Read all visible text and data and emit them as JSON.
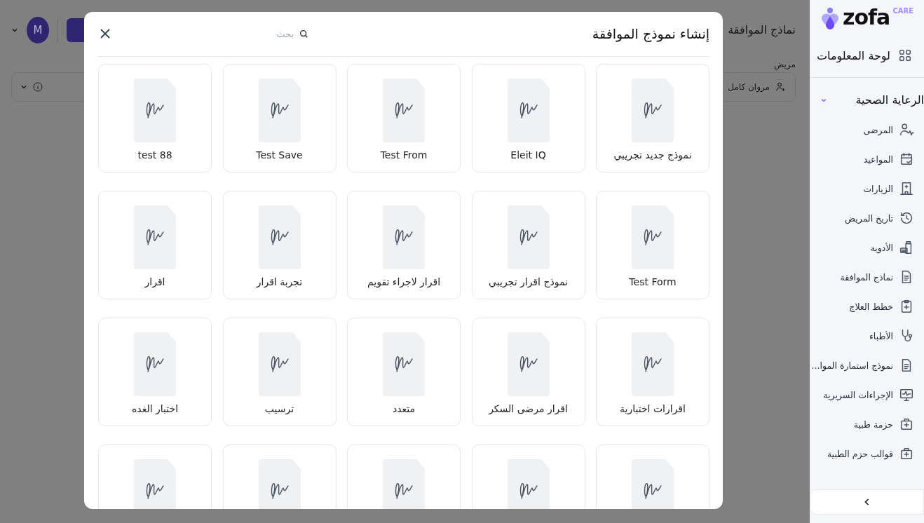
{
  "main": {
    "avatar": "M",
    "title": "نماذج الموافقة",
    "patient_label": "مريض",
    "patient_value": "مروان كامل"
  },
  "sidebar": {
    "logo": {
      "name": "zofa",
      "tag": "CARE"
    },
    "dashboard": "لوحة المعلومات",
    "group": {
      "label": "الرعاية الصحية",
      "expanded": true,
      "items": [
        {
          "label": "المرضى"
        },
        {
          "label": "المواعيد"
        },
        {
          "label": "الزيارات"
        },
        {
          "label": "تاريخ المريض"
        },
        {
          "label": "الأدوية"
        },
        {
          "label": "نماذج الموافقة"
        },
        {
          "label": "خطط العلاج"
        },
        {
          "label": "الأطباء"
        },
        {
          "label": "نموذج استمارة الموا..."
        },
        {
          "label": "الإجراءات السريرية"
        },
        {
          "label": "حزمة طبية"
        },
        {
          "label": "قوالب حزم الطبية"
        }
      ]
    }
  },
  "modal": {
    "title": "إنشاء نموذج الموافقة",
    "search": {
      "placeholder": "بحث"
    },
    "templates": [
      {
        "kind": "form",
        "title": "نموذج جديد تجريبي"
      },
      {
        "kind": "form",
        "title": "Eleit IQ"
      },
      {
        "kind": "form",
        "title": "Test From"
      },
      {
        "kind": "form",
        "title": "Test Save"
      },
      {
        "kind": "form",
        "title": "test 88"
      },
      {
        "kind": "form",
        "title": "Test Form"
      },
      {
        "kind": "form",
        "title": "نموذج اقرار تجريبي"
      },
      {
        "kind": "form",
        "title": "اقرار لاجراء تقويم"
      },
      {
        "kind": "form",
        "title": "تجربة اقرار"
      },
      {
        "kind": "form",
        "title": "اقرار"
      },
      {
        "kind": "form",
        "title": "اقرارات اختبارية"
      },
      {
        "kind": "form",
        "title": "اقرار مرضى السكر"
      },
      {
        "kind": "form",
        "title": "متعدد"
      },
      {
        "kind": "form",
        "title": "ترسيب"
      },
      {
        "kind": "form",
        "title": "اختبار الغده"
      },
      {
        "kind": "partial"
      },
      {
        "kind": "partial"
      },
      {
        "kind": "partial"
      },
      {
        "kind": "partial"
      },
      {
        "kind": "partial"
      }
    ]
  }
}
